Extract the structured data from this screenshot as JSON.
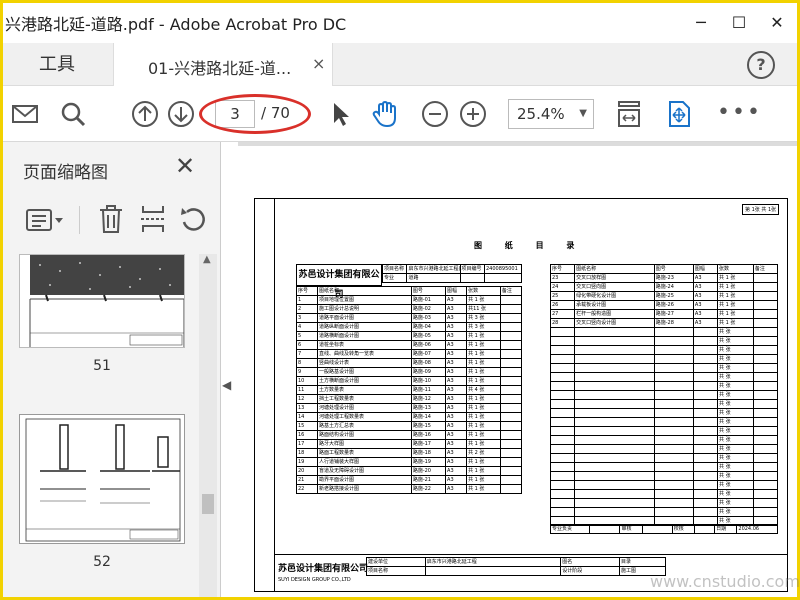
{
  "window": {
    "title": "兴港路北延-道路.pdf - Adobe Acrobat Pro DC",
    "minimize": "─",
    "maximize": "☐",
    "close": "✕"
  },
  "tabs": {
    "tools": "工具",
    "document": "01-兴港路北延-道...",
    "close": "×",
    "help": "?"
  },
  "toolbar": {
    "current_page": "3",
    "total_pages": "/ 70",
    "zoom": "25.4%",
    "zoom_caret": "▼",
    "more": "•••",
    "icons": [
      "mail-icon",
      "search-icon",
      "prev-page-icon",
      "next-page-icon",
      "select-cursor-icon",
      "hand-tool-icon",
      "zoom-out-icon",
      "zoom-in-icon",
      "fit-page-icon",
      "scroll-mode-icon"
    ]
  },
  "panel": {
    "title": "页面缩略图",
    "close": "✕",
    "thumbnails": [
      {
        "label": "51"
      },
      {
        "label": "52"
      }
    ]
  },
  "doc": {
    "heading": "图  纸  目  录",
    "corner": "第 1张 共 1张",
    "company": "苏邑设计集团有限公司",
    "company_en": "SUYI DESIGN GROUP CO.,LTD",
    "header_row1": [
      "项目名称",
      "启东市兴港路北延工程(道路部分)",
      "项目编号",
      "2400895001"
    ],
    "header_row2": [
      "专业",
      "道路",
      "",
      ""
    ],
    "col_headers": [
      "序号",
      "图纸名称",
      "图号",
      "图幅",
      "张数",
      "备注"
    ],
    "left_rows": [
      [
        "1",
        "项目地理位置图",
        "路施-01",
        "A3",
        "共 1 张"
      ],
      [
        "2",
        "施工图设计总说明",
        "路施-02",
        "A3",
        "共11 张"
      ],
      [
        "3",
        "道路平面设计图",
        "路施-03",
        "A3",
        "共 3 张"
      ],
      [
        "4",
        "道路纵断面设计图",
        "路施-04",
        "A3",
        "共 3 张"
      ],
      [
        "5",
        "道路横断面设计图",
        "路施-05",
        "A3",
        "共 1 张"
      ],
      [
        "6",
        "道桩坐标表",
        "路施-06",
        "A3",
        "共 1 张"
      ],
      [
        "7",
        "直线、曲线及转角一览表",
        "路施-07",
        "A3",
        "共 1 张"
      ],
      [
        "8",
        "竖曲线设计表",
        "路施-08",
        "A3",
        "共 1 张"
      ],
      [
        "9",
        "一般路基设计图",
        "路施-09",
        "A3",
        "共 1 张"
      ],
      [
        "10",
        "土方横断面设计图",
        "路施-10",
        "A3",
        "共 1 张"
      ],
      [
        "11",
        "土方数量表",
        "路施-11",
        "A3",
        "共 4 张"
      ],
      [
        "12",
        "挡土工程数量表",
        "路施-12",
        "A3",
        "共 1 张"
      ],
      [
        "13",
        "河塘处理设计图",
        "路施-13",
        "A3",
        "共 1 张"
      ],
      [
        "14",
        "河塘处理工程数量表",
        "路施-14",
        "A3",
        "共 1 张"
      ],
      [
        "15",
        "路基土方汇总表",
        "路施-15",
        "A3",
        "共 1 张"
      ],
      [
        "16",
        "路面结构设计图",
        "路施-16",
        "A3",
        "共 1 张"
      ],
      [
        "17",
        "路牙大样图",
        "路施-17",
        "A3",
        "共 1 张"
      ],
      [
        "18",
        "路面工程数量表",
        "路施-18",
        "A3",
        "共 2 张"
      ],
      [
        "19",
        "人行道铺装大样图",
        "路施-19",
        "A3",
        "共 1 张"
      ],
      [
        "20",
        "盲道及无障碍设计图",
        "路施-20",
        "A3",
        "共 1 张"
      ],
      [
        "21",
        "勘界平面设计图",
        "路施-21",
        "A3",
        "共 1 张"
      ],
      [
        "22",
        "新老路搭接设计图",
        "路施-22",
        "A3",
        "共 1 张"
      ]
    ],
    "right_rows": [
      [
        "23",
        "交叉口放样图",
        "路施-23",
        "A3",
        "共 1 张"
      ],
      [
        "24",
        "交叉口竖向图",
        "路施-24",
        "A3",
        "共 1 张"
      ],
      [
        "25",
        "绿化带硬化设计图",
        "路施-25",
        "A3",
        "共 1 张"
      ],
      [
        "26",
        "承载板设计图",
        "路施-26",
        "A3",
        "共 1 张"
      ],
      [
        "27",
        "栏杆一般构造图",
        "路施-27",
        "A3",
        "共 1 张"
      ],
      [
        "28",
        "交叉口竖向设计图",
        "路施-28",
        "A3",
        "共 1 张"
      ]
    ],
    "empty_suffix": "共   张",
    "bottom_labels": [
      "专业负责",
      "审核",
      "校核",
      "日期"
    ],
    "date": "2024.06",
    "footer_fields": [
      "建设单位",
      "启东市兴港路北延工程",
      "图名",
      "目录"
    ],
    "footer_fields2": [
      "项目名称",
      "设计阶段",
      "施工图"
    ]
  },
  "watermark": "www.cnstudio.com"
}
